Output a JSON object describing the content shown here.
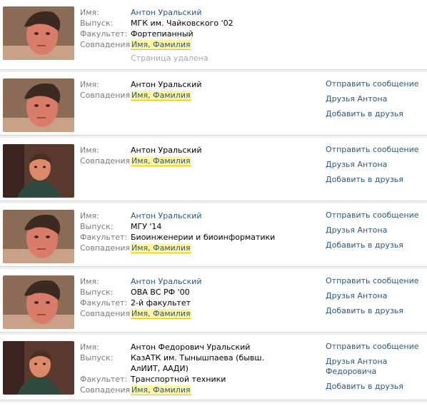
{
  "labels": {
    "name": "Имя:",
    "graduation": "Выпуск:",
    "faculty": "Факультет:",
    "matches": "Совпадения:"
  },
  "results": [
    {
      "name": "Антон Уральский",
      "graduation": "МГК им. Чайковского '02",
      "faculty": "Фортепианный",
      "matches": "Имя, Фамилия",
      "status": "Страница удалена",
      "photo": "young-man-portrait"
    },
    {
      "name": "Антон Уральский",
      "matches": "Имя, Фамилия",
      "actions": [
        "Отправить сообщение",
        "Друзья Антона",
        "Добавить в друзья"
      ],
      "photo": "young-man-portrait"
    },
    {
      "name": "Антон Уральский",
      "matches": "Имя, Фамилия",
      "actions": [
        "Отправить сообщение",
        "Друзья Антона",
        "Добавить в друзья"
      ],
      "photo": "dark-shirt-portrait"
    },
    {
      "name": "Антон Уральский",
      "graduation": "МГУ '14",
      "faculty": "Биоинженерии и биоинформатики",
      "matches": "Имя, Фамилия",
      "actions": [
        "Отправить сообщение",
        "Друзья Антона",
        "Добавить в друзья"
      ],
      "photo": "young-man-portrait"
    },
    {
      "name": "Антон Уральский",
      "graduation": "ОВА ВС РФ '00",
      "faculty": "2-й факультет",
      "matches": "Имя, Фамилия",
      "actions": [
        "Отправить сообщение",
        "Друзья Антона",
        "Добавить в друзья"
      ],
      "photo": "young-man-portrait"
    },
    {
      "name": "Антон Федорович Уральский",
      "graduation": "КазАТК им. Тынышпаева (бывш. АлИИТ, ААДИ)",
      "faculty": "Транспортной техники",
      "matches": "Имя, Фамилия",
      "actions": [
        "Отправить сообщение",
        "Друзья Антона Федоровича",
        "Добавить в друзья"
      ],
      "photo": "dark-shirt-portrait"
    }
  ]
}
